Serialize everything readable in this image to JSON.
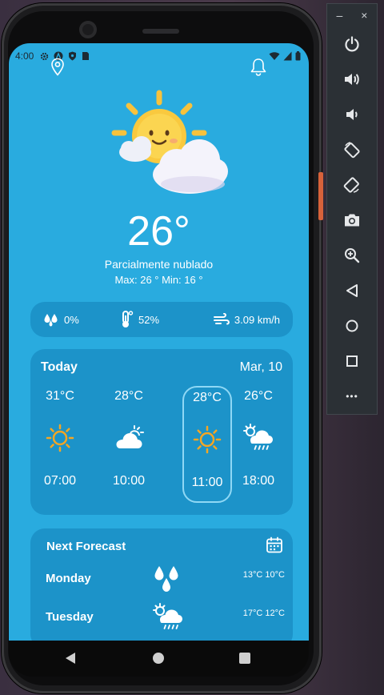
{
  "status_bar": {
    "time": "4:00"
  },
  "current": {
    "temperature": "26°",
    "condition": "Parcialmente nublado",
    "minmax": "Max: 26 ° Min: 16 °"
  },
  "stats": {
    "precipitation": "0%",
    "humidity": "52%",
    "wind": "3.09 km/h"
  },
  "today": {
    "title": "Today",
    "date": "Mar, 10",
    "hours": [
      {
        "temp": "31°C",
        "time": "07:00",
        "icon": "sun-icon"
      },
      {
        "temp": "28°C",
        "time": "10:00",
        "icon": "cloud-sun-icon"
      },
      {
        "temp": "28°C",
        "time": "11:00",
        "icon": "sun-icon",
        "selected": true
      },
      {
        "temp": "26°C",
        "time": "18:00",
        "icon": "sun-cloud-rain-icon"
      }
    ]
  },
  "next_forecast": {
    "title": "Next Forecast",
    "days": [
      {
        "day": "Monday",
        "temps": "13°C 10°C",
        "icon": "raindrops-icon"
      },
      {
        "day": "Tuesday",
        "temps": "17°C 12°C",
        "icon": "sun-cloud-rain-icon"
      }
    ]
  },
  "emulator": {
    "minimize": "–",
    "close": "×",
    "more": "•••"
  },
  "colors": {
    "background": "#29abdf",
    "card": "#1c93c9",
    "sun": "#f5a623"
  }
}
